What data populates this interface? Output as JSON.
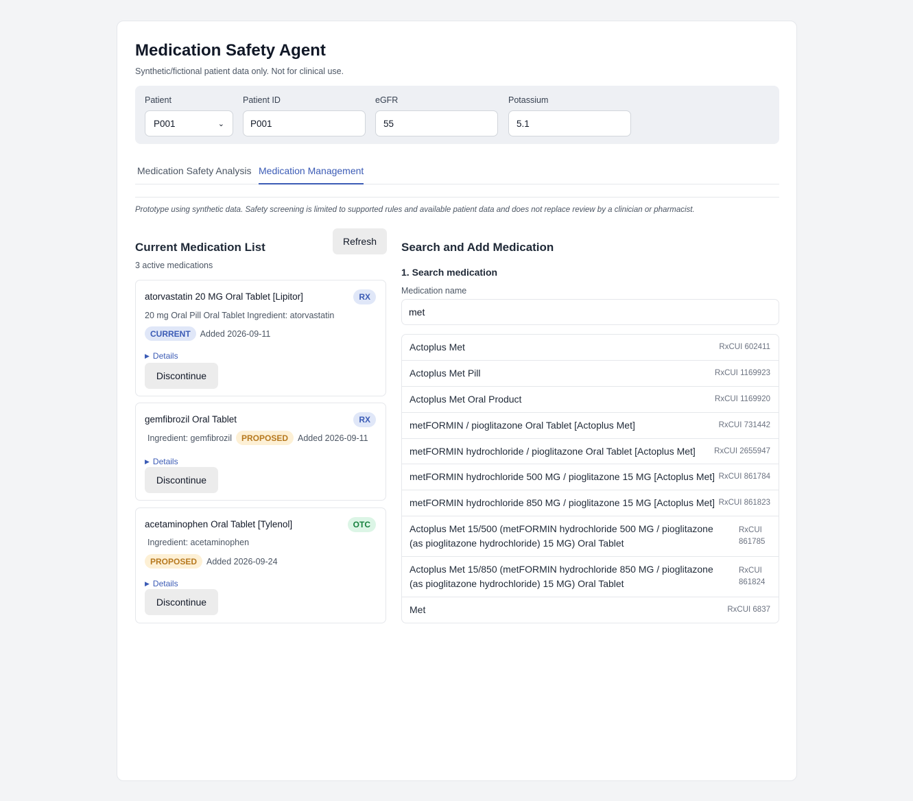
{
  "header": {
    "title": "Medication Safety Agent",
    "subtitle": "Synthetic/fictional patient data only. Not for clinical use."
  },
  "patient": {
    "patient_label": "Patient",
    "patient_value": "P001",
    "patient_id_label": "Patient ID",
    "patient_id_value": "P001",
    "egfr_label": "eGFR",
    "egfr_value": "55",
    "potassium_label": "Potassium",
    "potassium_value": "5.1"
  },
  "tabs": [
    {
      "label": "Medication Safety Analysis",
      "active": false
    },
    {
      "label": "Medication Management",
      "active": true
    }
  ],
  "disclaimer": "Prototype using synthetic data. Safety screening is limited to supported rules and available patient data and does not replace review by a clinician or pharmacist.",
  "current_list": {
    "title": "Current Medication List",
    "refresh_label": "Refresh",
    "count_text": "3 active medications",
    "details_label": "Details",
    "discontinue_label": "Discontinue",
    "items": [
      {
        "name": "atorvastatin 20 MG Oral Tablet [Lipitor]",
        "type": "RX",
        "info": "20 mg Oral Pill Oral Tablet Ingredient: atorvastatin",
        "status": "CURRENT",
        "added": "Added 2026-09-11"
      },
      {
        "name": "gemfibrozil Oral Tablet",
        "type": "RX",
        "info": "Ingredient: gemfibrozil",
        "status": "PROPOSED",
        "added": "Added 2026-09-11"
      },
      {
        "name": "acetaminophen Oral Tablet [Tylenol]",
        "type": "OTC",
        "info": "Ingredient: acetaminophen",
        "status": "PROPOSED",
        "added": "Added 2026-09-24"
      }
    ]
  },
  "search": {
    "title": "Search and Add Medication",
    "step_label": "1. Search medication",
    "field_label": "Medication name",
    "query": "met",
    "results": [
      {
        "name": "Actoplus Met",
        "code": "RxCUI 602411"
      },
      {
        "name": "Actoplus Met Pill",
        "code": "RxCUI 1169923"
      },
      {
        "name": "Actoplus Met Oral Product",
        "code": "RxCUI 1169920"
      },
      {
        "name": "metFORMIN / pioglitazone Oral Tablet [Actoplus Met]",
        "code": "RxCUI 731442"
      },
      {
        "name": "metFORMIN hydrochloride / pioglitazone Oral Tablet [Actoplus Met]",
        "code": "RxCUI 2655947"
      },
      {
        "name": "metFORMIN hydrochloride 500 MG / pioglitazone 15 MG [Actoplus Met]",
        "code": "RxCUI 861784"
      },
      {
        "name": "metFORMIN hydrochloride 850 MG / pioglitazone 15 MG [Actoplus Met]",
        "code": "RxCUI 861823"
      },
      {
        "name": "Actoplus Met 15/500 (metFORMIN hydrochloride 500 MG / pioglitazone (as pioglitazone hydrochloride) 15 MG) Oral Tablet",
        "code": "RxCUI 861785"
      },
      {
        "name": "Actoplus Met 15/850 (metFORMIN hydrochloride 850 MG / pioglitazone (as pioglitazone hydrochloride) 15 MG) Oral Tablet",
        "code": "RxCUI 861824"
      },
      {
        "name": "Met",
        "code": "RxCUI 6837"
      }
    ]
  }
}
